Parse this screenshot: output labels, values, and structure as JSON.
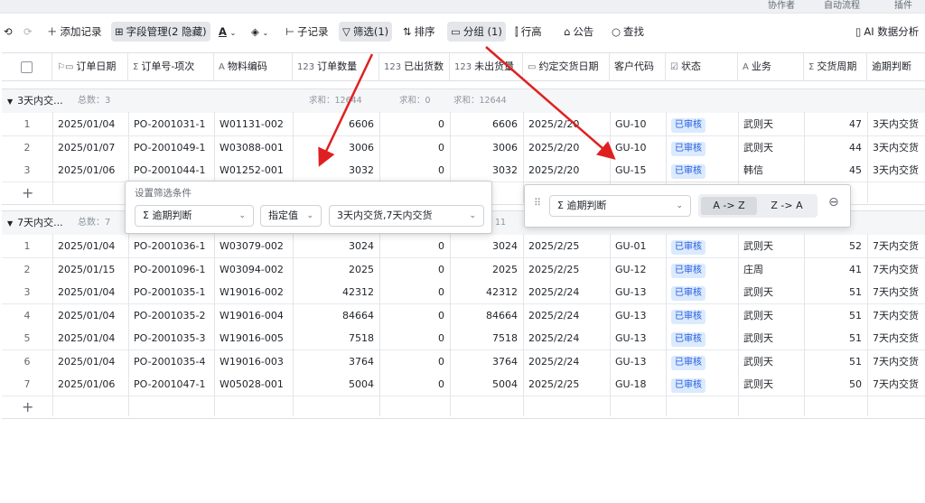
{
  "topstrip": {
    "frag1": "协作者",
    "frag2": "自动流程",
    "frag3": "插件"
  },
  "toolbar": {
    "add_record": "添加记录",
    "field_mgmt": "字段管理(2 隐藏)",
    "sub_record": "子记录",
    "filter": "筛选(1)",
    "sort": "排序",
    "group": "分组 (1)",
    "row_height": "行高",
    "notice": "公告",
    "search": "查找",
    "ai": "AI 数据分析"
  },
  "columns": [
    {
      "icon": "flag-calendar-icon",
      "label": "订单日期"
    },
    {
      "icon": "sigma-icon",
      "label": "订单号-项次"
    },
    {
      "icon": "text-icon",
      "label": "物料编码"
    },
    {
      "icon": "number-icon",
      "label": "订单数量"
    },
    {
      "icon": "number-icon",
      "label": "已出货数"
    },
    {
      "icon": "number-icon",
      "label": "未出货量"
    },
    {
      "icon": "calendar-icon",
      "label": "约定交货日期"
    },
    {
      "icon": "",
      "label": "客户代码"
    },
    {
      "icon": "checkbox-icon",
      "label": "状态"
    },
    {
      "icon": "text-icon",
      "label": "业务"
    },
    {
      "icon": "sigma-icon",
      "label": "交货周期"
    },
    {
      "icon": "",
      "label": "逾期判断"
    }
  ],
  "groups": [
    {
      "name": "3天内交...",
      "count": "总数：3",
      "sum1": "求和：12644",
      "sum2": "求和：0",
      "sum3": "求和：12644",
      "rows": [
        {
          "n": "1",
          "date": "2025/01/04",
          "order": "PO-2001031-1",
          "mat": "W01131-002",
          "qty": "6606",
          "shipped": "0",
          "unshipped": "6606",
          "due": "2025/2/20",
          "cust": "GU-10",
          "status": "已审核",
          "biz": "武则天",
          "cycle": "47",
          "judge": "3天内交货"
        },
        {
          "n": "2",
          "date": "2025/01/07",
          "order": "PO-2001049-1",
          "mat": "W03088-001",
          "qty": "3006",
          "shipped": "0",
          "unshipped": "3006",
          "due": "2025/2/20",
          "cust": "GU-10",
          "status": "已审核",
          "biz": "武则天",
          "cycle": "44",
          "judge": "3天内交货"
        },
        {
          "n": "3",
          "date": "2025/01/06",
          "order": "PO-2001044-1",
          "mat": "W01252-001",
          "qty": "3032",
          "shipped": "0",
          "unshipped": "3032",
          "due": "2025/2/20",
          "cust": "GU-15",
          "status": "已审核",
          "biz": "韩信",
          "cycle": "45",
          "judge": "3天内交货"
        }
      ]
    },
    {
      "name": "7天内交...",
      "count": "总数：7",
      "sum_tail": "11",
      "rows": [
        {
          "n": "1",
          "date": "2025/01/04",
          "order": "PO-2001036-1",
          "mat": "W03079-002",
          "qty": "3024",
          "shipped": "0",
          "unshipped": "3024",
          "due": "2025/2/25",
          "cust": "GU-01",
          "status": "已审核",
          "biz": "武则天",
          "cycle": "52",
          "judge": "7天内交货"
        },
        {
          "n": "2",
          "date": "2025/01/15",
          "order": "PO-2001096-1",
          "mat": "W03094-002",
          "qty": "2025",
          "shipped": "0",
          "unshipped": "2025",
          "due": "2025/2/25",
          "cust": "GU-12",
          "status": "已审核",
          "biz": "庄周",
          "cycle": "41",
          "judge": "7天内交货"
        },
        {
          "n": "3",
          "date": "2025/01/04",
          "order": "PO-2001035-1",
          "mat": "W19016-002",
          "qty": "42312",
          "shipped": "0",
          "unshipped": "42312",
          "due": "2025/2/24",
          "cust": "GU-13",
          "status": "已审核",
          "biz": "武则天",
          "cycle": "51",
          "judge": "7天内交货"
        },
        {
          "n": "4",
          "date": "2025/01/04",
          "order": "PO-2001035-2",
          "mat": "W19016-004",
          "qty": "84664",
          "shipped": "0",
          "unshipped": "84664",
          "due": "2025/2/24",
          "cust": "GU-13",
          "status": "已审核",
          "biz": "武则天",
          "cycle": "51",
          "judge": "7天内交货"
        },
        {
          "n": "5",
          "date": "2025/01/04",
          "order": "PO-2001035-3",
          "mat": "W19016-005",
          "qty": "7518",
          "shipped": "0",
          "unshipped": "7518",
          "due": "2025/2/24",
          "cust": "GU-13",
          "status": "已审核",
          "biz": "武则天",
          "cycle": "51",
          "judge": "7天内交货"
        },
        {
          "n": "6",
          "date": "2025/01/04",
          "order": "PO-2001035-4",
          "mat": "W19016-003",
          "qty": "3764",
          "shipped": "0",
          "unshipped": "3764",
          "due": "2025/2/24",
          "cust": "GU-13",
          "status": "已审核",
          "biz": "武则天",
          "cycle": "51",
          "judge": "7天内交货"
        },
        {
          "n": "7",
          "date": "2025/01/06",
          "order": "PO-2001047-1",
          "mat": "W05028-001",
          "qty": "5004",
          "shipped": "0",
          "unshipped": "5004",
          "due": "2025/2/25",
          "cust": "GU-18",
          "status": "已审核",
          "biz": "武则天",
          "cycle": "50",
          "judge": "7天内交货"
        }
      ]
    }
  ],
  "filter_popover": {
    "title": "设置筛选条件",
    "field": "逾期判断",
    "operator": "指定值",
    "value": "3天内交货,7天内交货"
  },
  "group_popover": {
    "field": "逾期判断",
    "asc": "A -> Z",
    "desc": "Z -> A"
  },
  "colors": {
    "accent": "#245bdb",
    "arrow": "#e02020",
    "badge_bg": "#dbeafe"
  }
}
